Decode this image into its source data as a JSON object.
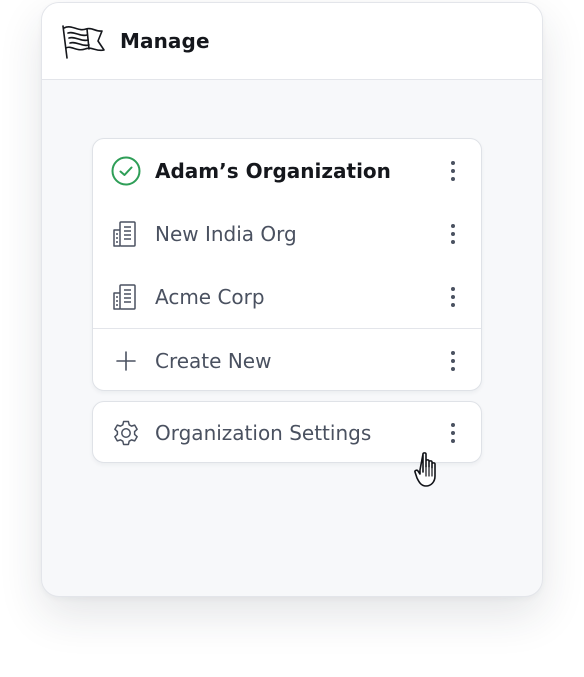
{
  "header": {
    "title": "Manage",
    "logo_icon": "flag-icon"
  },
  "organizations": {
    "items": [
      {
        "label": "Adam’s Organization",
        "icon": "check-circle-icon",
        "active": true
      },
      {
        "label": "New India Org",
        "icon": "building-icon",
        "active": false
      },
      {
        "label": "Acme Corp",
        "icon": "building-icon",
        "active": false
      }
    ],
    "create_new": {
      "label": "Create New",
      "icon": "plus-icon"
    }
  },
  "settings": {
    "label": "Organization Settings",
    "icon": "gear-icon"
  },
  "colors": {
    "active_check": "#2e9e57",
    "text_active": "#15171c",
    "text_muted": "#4a5160",
    "border": "#dfe2e7",
    "panel_bg": "#f7f8fa"
  },
  "pointer": "hand-pointer-icon"
}
